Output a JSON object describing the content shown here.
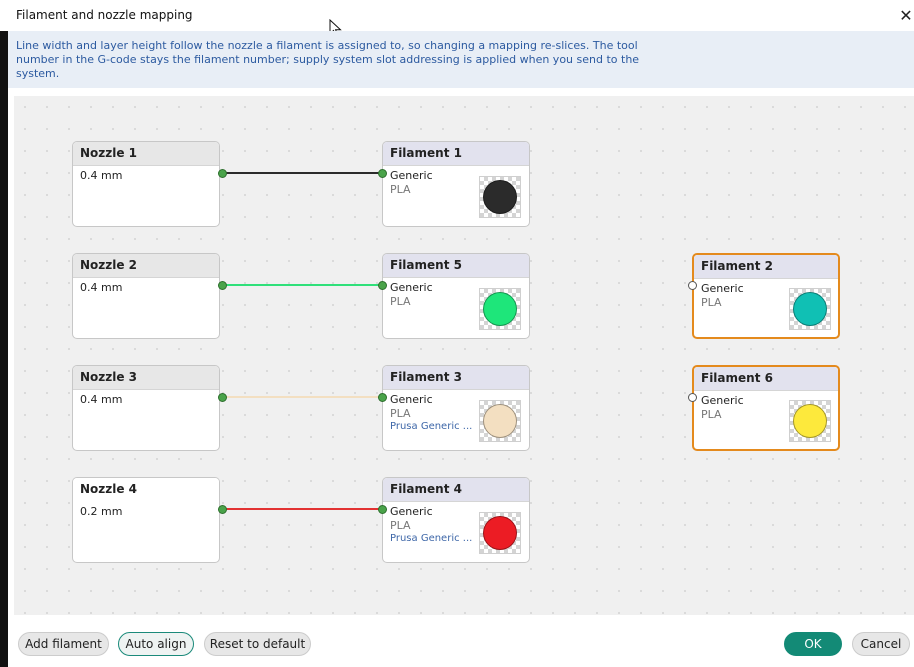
{
  "window": {
    "title": "Filament and nozzle mapping",
    "close_glyph": "✕"
  },
  "info": {
    "text": "Line width and layer height follow the nozzle a filament is assigned to, so changing a mapping re-slices. The tool number in the G-code stays the filament number; supply system slot addressing is applied when you send to the system."
  },
  "nozzles": [
    {
      "label": "Nozzle 1",
      "size": "0.4 mm"
    },
    {
      "label": "Nozzle 2",
      "size": "0.4 mm"
    },
    {
      "label": "Nozzle 3",
      "size": "0.4 mm"
    },
    {
      "label": "Nozzle 4",
      "size": "0.2 mm"
    }
  ],
  "mapped_filaments": [
    {
      "label": "Filament 1",
      "vendor": "Generic",
      "type": "PLA",
      "profile": "",
      "color": "#2b2b2b"
    },
    {
      "label": "Filament 5",
      "vendor": "Generic",
      "type": "PLA",
      "profile": "",
      "color": "#1ee67a"
    },
    {
      "label": "Filament 3",
      "vendor": "Generic",
      "type": "PLA",
      "profile": "Prusa Generic ...",
      "color": "#f3dfc1"
    },
    {
      "label": "Filament 4",
      "vendor": "Generic",
      "type": "PLA",
      "profile": "Prusa Generic ...",
      "color": "#ec1c24"
    }
  ],
  "unmapped_filaments": [
    {
      "label": "Filament 2",
      "vendor": "Generic",
      "type": "PLA",
      "color": "#10c0b4"
    },
    {
      "label": "Filament 6",
      "vendor": "Generic",
      "type": "PLA",
      "color": "#fde93c"
    }
  ],
  "link_colors": [
    "#2b2b2b",
    "#2fe07a",
    "#f3dfc1",
    "#e23232"
  ],
  "footer": {
    "add_filament": "Add filament",
    "auto_align": "Auto align",
    "reset": "Reset to default",
    "ok": "OK",
    "cancel": "Cancel"
  },
  "colors": {
    "accent": "#138a76",
    "info_text": "#2c5aa0",
    "unmapped_border": "#e48a1d",
    "port": "#4aa34a"
  }
}
